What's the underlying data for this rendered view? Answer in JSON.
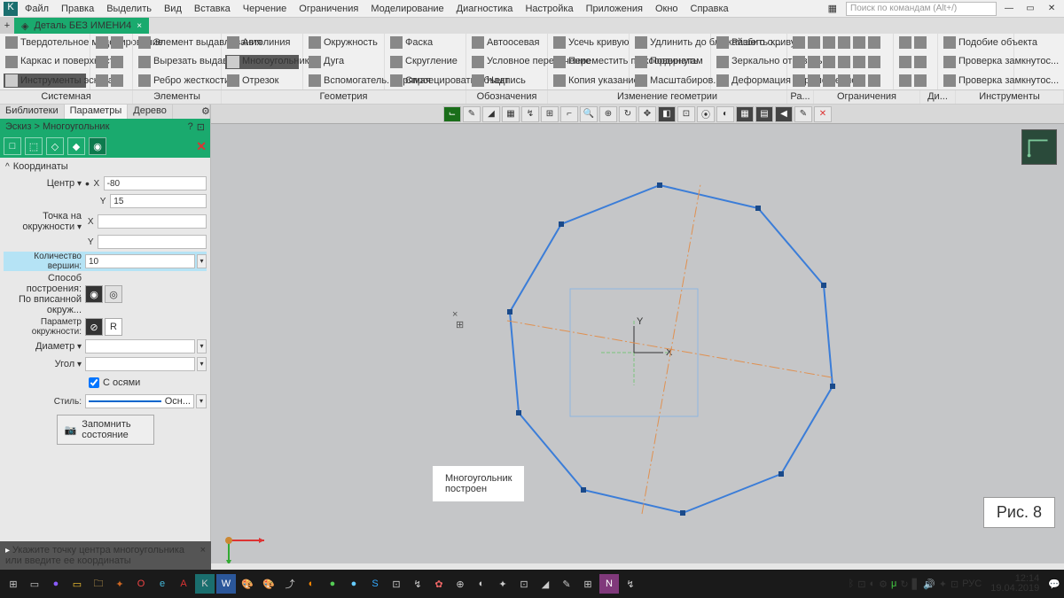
{
  "menu": {
    "items": [
      "Файл",
      "Правка",
      "Выделить",
      "Вид",
      "Вставка",
      "Черчение",
      "Ограничения",
      "Моделирование",
      "Диагностика",
      "Настройка",
      "Приложения",
      "Окно",
      "Справка"
    ],
    "search_ph": "Поиск по командам (Alt+/)"
  },
  "doc": {
    "title": "Деталь БЕЗ ИМЕНИ4"
  },
  "ribbon": {
    "g1": [
      "Твердотельное моделирование",
      "Каркас и поверхности",
      "Инструменты эскиза"
    ],
    "g2": [
      "Элемент выдавливания",
      "Вырезать выдавливанием",
      "Ребро жесткости"
    ],
    "g3": [
      "Автолиния",
      "Многоугольник",
      "Отрезок"
    ],
    "g4": [
      "Окружность",
      "Дуга",
      "Вспомогатель... прямая"
    ],
    "g5": [
      "Фаска",
      "Скругление",
      "Спроецировать объект"
    ],
    "g6": [
      "Автоосевая",
      "Условное пересечение",
      "Надпись"
    ],
    "g7": [
      "Усечь кривую",
      "Переместить по координатам",
      "Копия указанием"
    ],
    "g8": [
      "Удлинить до ближайшего о...",
      "Повернуть",
      "Масштабиров..."
    ],
    "g9": [
      "Разбить кривую",
      "Зеркально отразить",
      "Деформация перемещением"
    ],
    "g10": [
      "Подобие объекта",
      "Проверка замкнутос...",
      "Проверка замкнутос..."
    ],
    "labels": [
      "Системная",
      "Элементы",
      "Геометрия",
      "Обозначения",
      "Изменение геометрии",
      "Ра...",
      "Ограничения",
      "Ди...",
      "Инструменты"
    ]
  },
  "left": {
    "tabs": [
      "Библиотеки",
      "Параметры",
      "Дерево"
    ],
    "crumb": "Эскиз > Многоугольник",
    "sec_coord": "Координаты",
    "center": "Центр",
    "center_x": "-80",
    "center_y": "15",
    "point": "Точка на окружности",
    "verts": "Количество вершин:",
    "verts_v": "10",
    "method": "Способ построения:",
    "method2": "По вписанной окруж...",
    "circparam": "Параметр окружности:",
    "R": "R",
    "diam": "Диаметр",
    "angle": "Угол",
    "axes": "С осями",
    "style": "Стиль:",
    "style_v": "Осн...",
    "memo": "Запомнить состояние",
    "hint": "Укажите точку центра многоугольника или введите ее координаты"
  },
  "callout": {
    "l1": "Многоугольник",
    "l2": "построен"
  },
  "fig": "Рис. 8",
  "clock": {
    "time": "12:14",
    "date": "19.04.2019"
  },
  "lang": "РУС"
}
